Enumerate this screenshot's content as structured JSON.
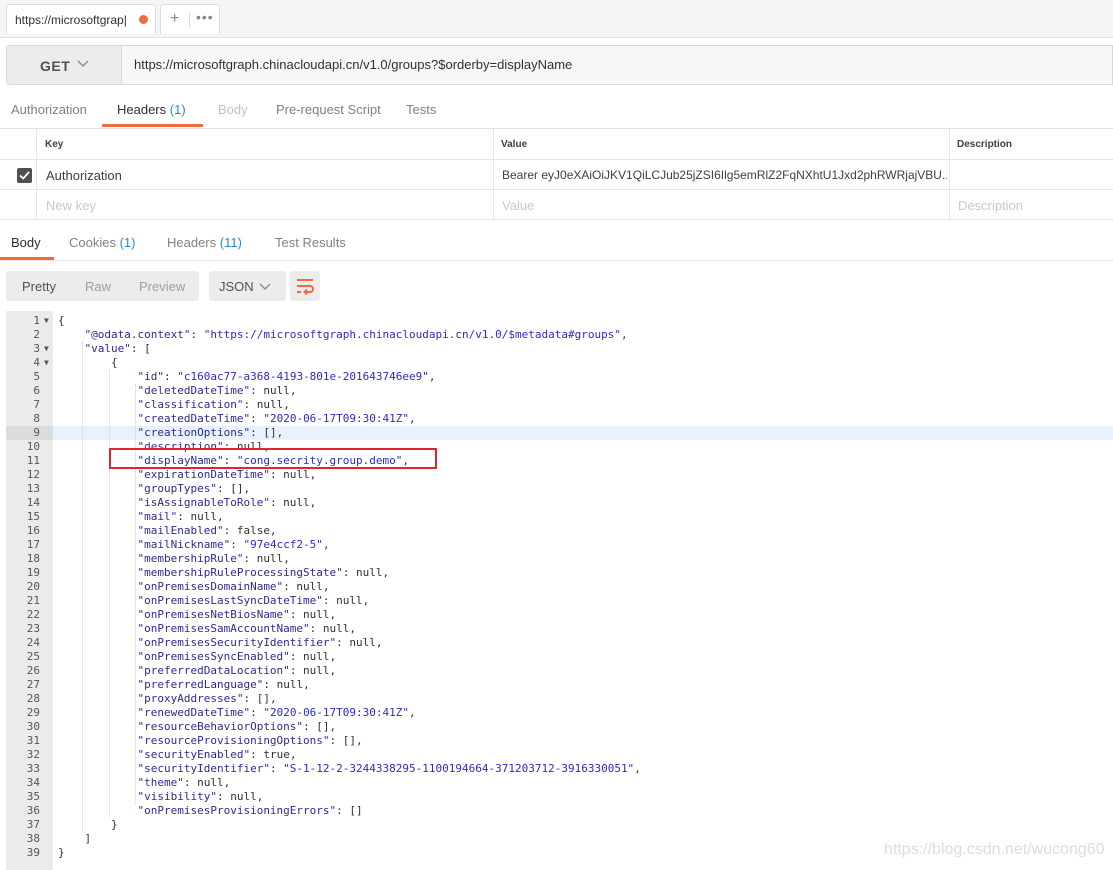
{
  "tab": {
    "title": "https://microsoftgrap|"
  },
  "request": {
    "method": "GET",
    "url": "https://microsoftgraph.chinacloudapi.cn/v1.0/groups?$orderby=displayName"
  },
  "request_tabs": [
    {
      "label": "Authorization",
      "count": ""
    },
    {
      "label": "Headers",
      "count": "(1)"
    },
    {
      "label": "Body",
      "count": ""
    },
    {
      "label": "Pre-request Script",
      "count": ""
    },
    {
      "label": "Tests",
      "count": ""
    }
  ],
  "headers_table": {
    "columns": [
      "Key",
      "Value",
      "Description"
    ],
    "rows": [
      {
        "key": "Authorization",
        "value": "Bearer eyJ0eXAiOiJKV1QiLCJub25jZSI6Ilg5emRlZ2FqNXhtU1Jxd2phRWRjajVBU...",
        "description": ""
      }
    ],
    "new_row": {
      "key": "New key",
      "value": "Value",
      "description": "Description"
    }
  },
  "response_tabs": [
    {
      "label": "Body",
      "count": ""
    },
    {
      "label": "Cookies",
      "count": "(1)"
    },
    {
      "label": "Headers",
      "count": "(11)"
    },
    {
      "label": "Test Results",
      "count": ""
    }
  ],
  "view_modes": [
    "Pretty",
    "Raw",
    "Preview"
  ],
  "format": "JSON",
  "code_lines": [
    "{",
    "    \"@odata.context\": \"https://microsoftgraph.chinacloudapi.cn/v1.0/$metadata#groups\",",
    "    \"value\": [",
    "        {",
    "            \"id\": \"c160ac77-a368-4193-801e-201643746ee9\",",
    "            \"deletedDateTime\": null,",
    "            \"classification\": null,",
    "            \"createdDateTime\": \"2020-06-17T09:30:41Z\",",
    "            \"creationOptions\": [],",
    "            \"description\": null,",
    "            \"displayName\": \"cong.secrity.group.demo\",",
    "            \"expirationDateTime\": null,",
    "            \"groupTypes\": [],",
    "            \"isAssignableToRole\": null,",
    "            \"mail\": null,",
    "            \"mailEnabled\": false,",
    "            \"mailNickname\": \"97e4ccf2-5\",",
    "            \"membershipRule\": null,",
    "            \"membershipRuleProcessingState\": null,",
    "            \"onPremisesDomainName\": null,",
    "            \"onPremisesLastSyncDateTime\": null,",
    "            \"onPremisesNetBiosName\": null,",
    "            \"onPremisesSamAccountName\": null,",
    "            \"onPremisesSecurityIdentifier\": null,",
    "            \"onPremisesSyncEnabled\": null,",
    "            \"preferredDataLocation\": null,",
    "            \"preferredLanguage\": null,",
    "            \"proxyAddresses\": [],",
    "            \"renewedDateTime\": \"2020-06-17T09:30:41Z\",",
    "            \"resourceBehaviorOptions\": [],",
    "            \"resourceProvisioningOptions\": [],",
    "            \"securityEnabled\": true,",
    "            \"securityIdentifier\": \"S-1-12-2-3244338295-1100194664-371203712-3916330051\",",
    "            \"theme\": null,",
    "            \"visibility\": null,",
    "            \"onPremisesProvisioningErrors\": []",
    "        }",
    "    ]",
    "}"
  ],
  "highlighted_line": 9,
  "folded_lines": [
    1,
    3,
    4
  ],
  "watermark": "https://blog.csdn.net/wucong60",
  "colors": {
    "accent": "#f26b3a",
    "count": "#2a8ad6",
    "highlight_box": "#e0262c"
  }
}
